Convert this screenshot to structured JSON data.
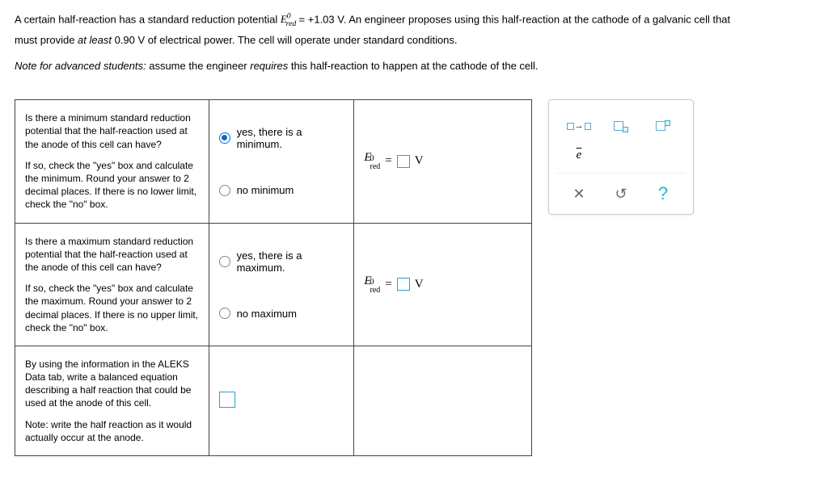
{
  "problem": {
    "line1_pre": "A certain half-reaction has a standard reduction potential ",
    "e0_var": "E",
    "e0_sup": "0",
    "e0_sub": "red",
    "e0_val": " = +1.03 V",
    "line1_post": ". An engineer proposes using this half-reaction at the cathode of a galvanic cell that",
    "line2_pre": "must provide ",
    "line2_italic": "at least",
    "line2_post": " 0.90 V of electrical power. The cell will operate under standard conditions.",
    "note_pre": "Note for advanced students:",
    "note_mid": " assume the engineer ",
    "note_italic": "requires",
    "note_post": " this half-reaction to happen at the cathode of the cell."
  },
  "rows": {
    "min": {
      "q1": "Is there a minimum standard reduction potential that the half-reaction used at the anode of this cell can have?",
      "q2": "If so, check the \"yes\" box and calculate the minimum. Round your answer to 2 decimal places. If there is no lower limit, check the \"no\" box.",
      "yes": "yes, there is a minimum.",
      "no": "no minimum"
    },
    "max": {
      "q1": "Is there a maximum standard reduction potential that the half-reaction used at the anode of this cell can have?",
      "q2": "If so, check the \"yes\" box and calculate the maximum. Round your answer to 2 decimal places. If there is no upper limit, check the \"no\" box.",
      "yes": "yes, there is a maximum.",
      "no": "no maximum"
    },
    "eqn": {
      "q1": "By using the information in the ALEKS Data tab, write a balanced equation describing a half reaction that could be used at the anode of this cell.",
      "q2_pre": "Note:",
      "q2_post": " write the half reaction as it would actually occur at the anode."
    }
  },
  "eq": {
    "var": "E",
    "sup": "0",
    "sub": "red",
    "equals": "=",
    "unit": "V"
  },
  "tools": {
    "arrow": "→",
    "e_overline": "e",
    "close": "✕",
    "reset": "↺",
    "help": "?"
  }
}
